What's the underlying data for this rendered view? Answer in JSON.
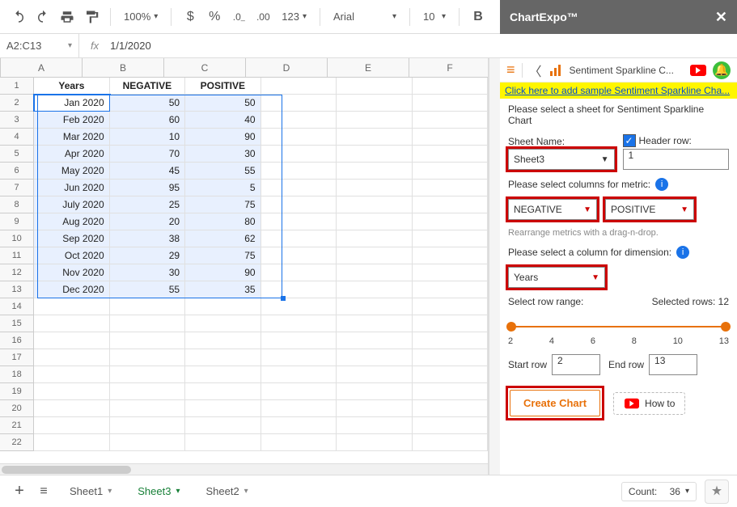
{
  "toolbar": {
    "zoom": "100%",
    "currency_icon": "$",
    "percent_icon": "%",
    "dec_down": ".0←",
    "dec_up": ".00",
    "more_fmt": "123",
    "font": "Arial",
    "font_size": "10",
    "bold": "B"
  },
  "namebox": "A2:C13",
  "formula": "1/1/2020",
  "columns": [
    "A",
    "B",
    "C",
    "D",
    "E",
    "F"
  ],
  "headers": [
    "Years",
    "NEGATIVE",
    "POSITIVE"
  ],
  "chart_data": {
    "type": "table",
    "columns": [
      "Years",
      "NEGATIVE",
      "POSITIVE"
    ],
    "rows": [
      {
        "Years": "Jan 2020",
        "NEGATIVE": 50,
        "POSITIVE": 50
      },
      {
        "Years": "Feb 2020",
        "NEGATIVE": 60,
        "POSITIVE": 40
      },
      {
        "Years": "Mar 2020",
        "NEGATIVE": 10,
        "POSITIVE": 90
      },
      {
        "Years": "Apr 2020",
        "NEGATIVE": 70,
        "POSITIVE": 30
      },
      {
        "Years": "May 2020",
        "NEGATIVE": 45,
        "POSITIVE": 55
      },
      {
        "Years": "Jun 2020",
        "NEGATIVE": 95,
        "POSITIVE": 5
      },
      {
        "Years": "July 2020",
        "NEGATIVE": 25,
        "POSITIVE": 75
      },
      {
        "Years": "Aug 2020",
        "NEGATIVE": 20,
        "POSITIVE": 80
      },
      {
        "Years": "Sep 2020",
        "NEGATIVE": 38,
        "POSITIVE": 62
      },
      {
        "Years": "Oct 2020",
        "NEGATIVE": 29,
        "POSITIVE": 75
      },
      {
        "Years": "Nov 2020",
        "NEGATIVE": 30,
        "POSITIVE": 90
      },
      {
        "Years": "Dec 2020",
        "NEGATIVE": 55,
        "POSITIVE": 35
      }
    ]
  },
  "extra_row_numbers": [
    14,
    15,
    16,
    17,
    18,
    19,
    20,
    21,
    22
  ],
  "sheets": {
    "items": [
      "Sheet1",
      "Sheet3",
      "Sheet2"
    ],
    "active": "Sheet3"
  },
  "status": {
    "count_label": "Count:",
    "count_value": "36"
  },
  "sidepanel": {
    "title": "ChartExpo™",
    "nav_title": "Sentiment Sparkline C...",
    "sample_link": "Click here to add sample Sentiment Sparkline Cha...",
    "sheet_prompt": "Please select a sheet for Sentiment Sparkline Chart",
    "sheet_label": "Sheet Name:",
    "sheet_value": "Sheet3",
    "header_row_label": "Header row:",
    "header_row_value": "1",
    "metric_prompt": "Please select columns for metric:",
    "metric1": "NEGATIVE",
    "metric2": "POSITIVE",
    "rearrange_hint": "Rearrange metrics with a drag-n-drop.",
    "dimension_prompt": "Please select a column for dimension:",
    "dimension_value": "Years",
    "range_label": "Select row range:",
    "selected_rows_label": "Selected rows: 12",
    "ticks": [
      "2",
      "4",
      "6",
      "8",
      "10",
      "13"
    ],
    "start_row_label": "Start row",
    "start_row_value": "2",
    "end_row_label": "End row",
    "end_row_value": "13",
    "create_btn": "Create Chart",
    "howto_btn": "How to"
  }
}
